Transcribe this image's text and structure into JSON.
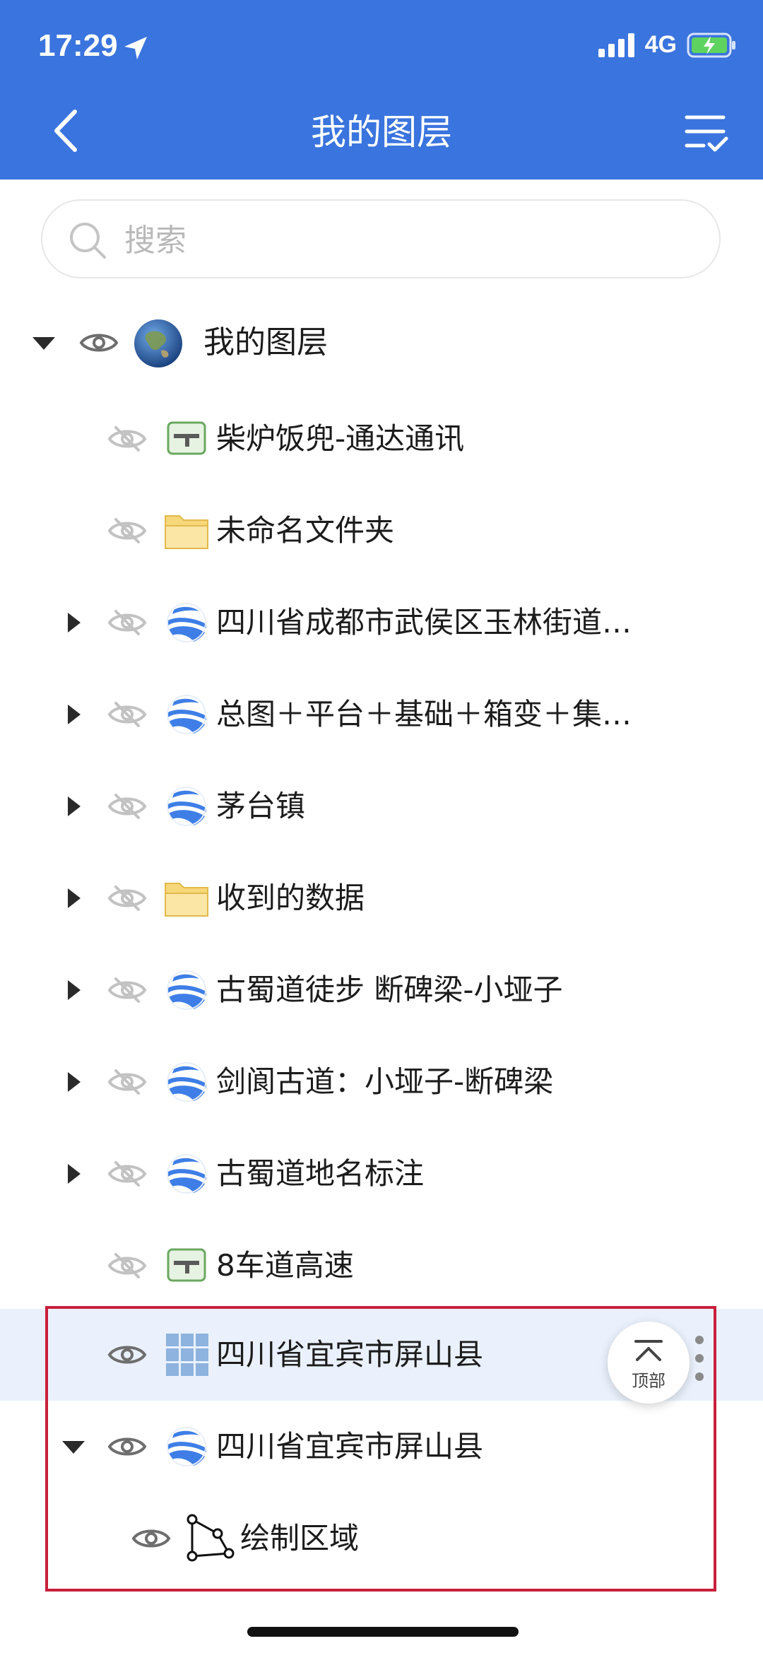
{
  "status": {
    "time": "17:29",
    "network": "4G"
  },
  "header": {
    "title": "我的图层"
  },
  "search": {
    "placeholder": "搜索",
    "value": ""
  },
  "colors": {
    "header_bg": "#3a74de",
    "selected_row": "#eaf1fc",
    "highlight": "#c8203b"
  },
  "tree": {
    "root": {
      "label": "我的图层",
      "icon": "globe-icon",
      "visible": true,
      "expanded": true
    },
    "items": [
      {
        "label": "柴炉饭兜-通达通讯",
        "icon": "road-layer-icon",
        "visible": false
      },
      {
        "label": "未命名文件夹",
        "icon": "folder-icon",
        "visible": false
      },
      {
        "label": "四川省成都市武侯区玉林街道…",
        "icon": "kml-icon",
        "visible": false,
        "expandable": true
      },
      {
        "label": "总图＋平台＋基础＋箱变＋集…",
        "icon": "kml-icon",
        "visible": false,
        "expandable": true
      },
      {
        "label": "茅台镇",
        "icon": "kml-icon",
        "visible": false,
        "expandable": true
      },
      {
        "label": "收到的数据",
        "icon": "folder-icon",
        "visible": false,
        "expandable": true
      },
      {
        "label": "古蜀道徒步 断碑梁-小垭子",
        "icon": "kml-icon",
        "visible": false,
        "expandable": true
      },
      {
        "label": "剑阆古道：小垭子-断碑梁",
        "icon": "kml-icon",
        "visible": false,
        "expandable": true
      },
      {
        "label": "古蜀道地名标注",
        "icon": "kml-icon",
        "visible": false,
        "expandable": true
      },
      {
        "label": "8车道高速",
        "icon": "road-layer-icon",
        "visible": false
      },
      {
        "label": "四川省宜宾市屏山县",
        "icon": "grid-layer-icon",
        "visible": true,
        "selected": true
      },
      {
        "label": "四川省宜宾市屏山县",
        "icon": "kml-icon",
        "visible": true,
        "expandable": true,
        "expanded": true
      },
      {
        "label": "绘制区域",
        "icon": "polygon-icon",
        "visible": true
      }
    ]
  },
  "fab": {
    "label": "顶部"
  }
}
